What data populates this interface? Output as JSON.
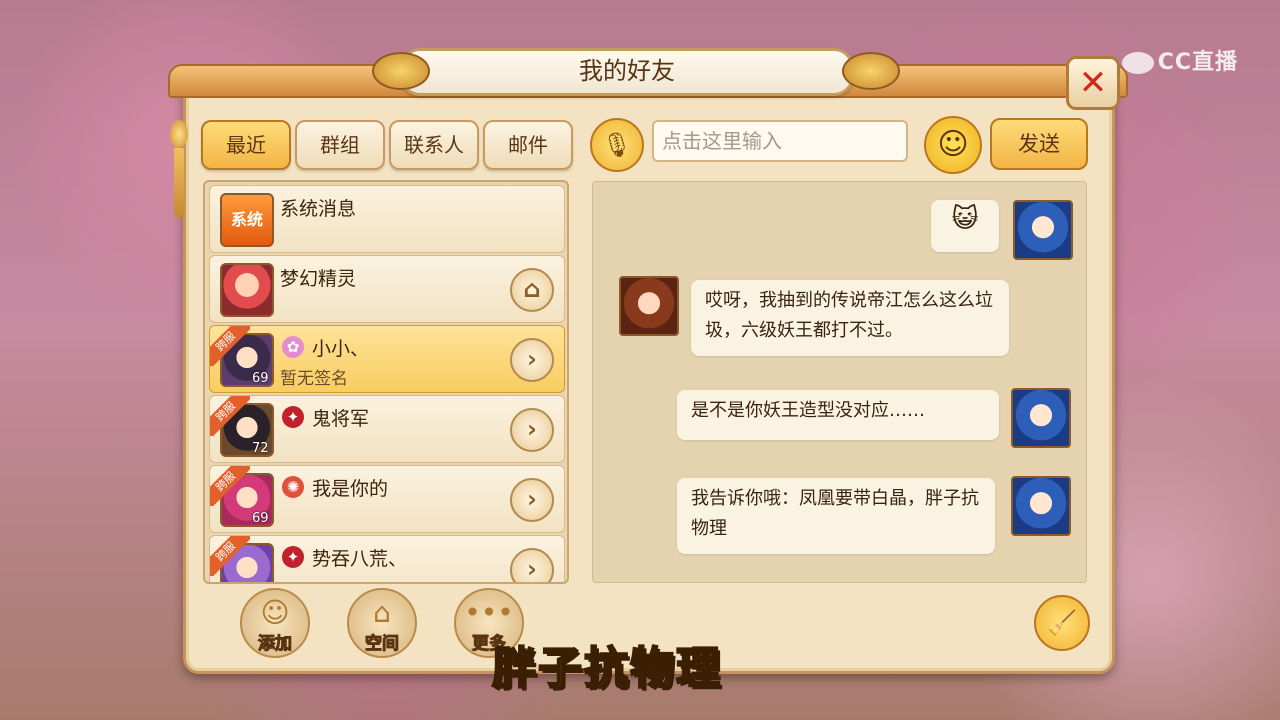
{
  "watermark": "CC直播",
  "window": {
    "title": "我的好友",
    "close_label": "✕"
  },
  "tabs": [
    {
      "label": "最近",
      "active": true
    },
    {
      "label": "群组",
      "active": false
    },
    {
      "label": "联系人",
      "active": false
    },
    {
      "label": "邮件",
      "active": false
    }
  ],
  "friends": [
    {
      "name": "系统消息",
      "avatar_label": "系统",
      "cross_server": false
    },
    {
      "name": "梦幻精灵",
      "cross_server": false,
      "action": "home"
    },
    {
      "name": "小小、",
      "signature": "暂无签名",
      "level": "69",
      "cross_server": true,
      "cross_label": "跨服",
      "active": true
    },
    {
      "name": "鬼将军",
      "level": "72",
      "cross_server": true,
      "cross_label": "跨服"
    },
    {
      "name": "我是你的",
      "level": "69",
      "cross_server": true,
      "cross_label": "跨服"
    },
    {
      "name": "势吞八荒、",
      "cross_server": true,
      "cross_label": "跨服"
    }
  ],
  "bottom_buttons": [
    {
      "label": "添加"
    },
    {
      "label": "空间"
    },
    {
      "label": "更多"
    }
  ],
  "chat": {
    "input_placeholder": "点击这里输入",
    "send_label": "发送",
    "messages": [
      {
        "side": "right",
        "type": "emoji",
        "text": ""
      },
      {
        "side": "left",
        "text": "哎呀，我抽到的传说帝江怎么这么垃圾，六级妖王都打不过。"
      },
      {
        "side": "right",
        "text": "是不是你妖王造型没对应……"
      },
      {
        "side": "right",
        "text": "我告诉你哦：凤凰要带白晶，胖子抗物理"
      }
    ]
  },
  "caption": "胖子抗物理",
  "colors": {
    "accent": "#f2b544",
    "frame": "#c7955a",
    "caption": "#ffd21f"
  }
}
